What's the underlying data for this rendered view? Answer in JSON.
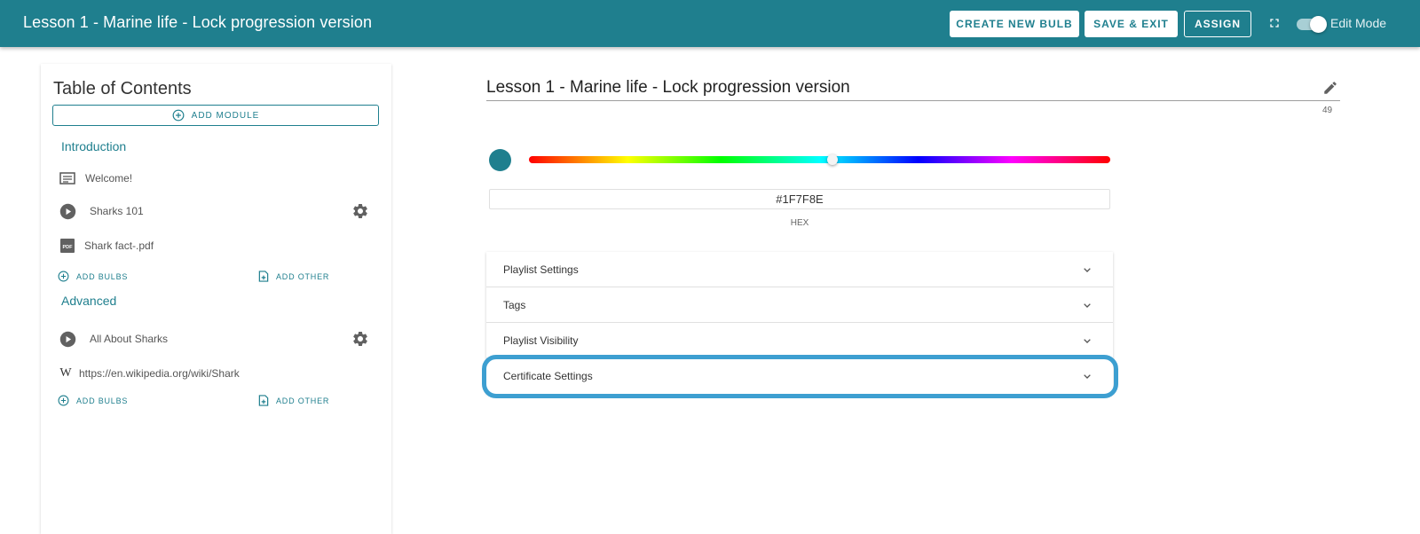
{
  "topbar": {
    "title": "Lesson 1 - Marine life - Lock progression version",
    "create_label": "CREATE NEW BULB",
    "save_label": "SAVE & EXIT",
    "assign_label": "ASSIGN",
    "edit_mode_label": "Edit Mode",
    "edit_mode_on": true
  },
  "sidebar": {
    "title": "Table of Contents",
    "add_module_label": "ADD MODULE",
    "modules": [
      {
        "title": "Introduction",
        "items": [
          {
            "label": "Welcome!",
            "icon": "article-icon"
          },
          {
            "label": "Sharks 101",
            "icon": "play-circle-icon"
          },
          {
            "label": "Shark fact-.pdf",
            "icon": "pdf-icon"
          }
        ],
        "add_bulbs_label": "ADD BULBS",
        "add_other_label": "ADD OTHER"
      },
      {
        "title": "Advanced",
        "items": [
          {
            "label": "All About Sharks",
            "icon": "play-circle-icon"
          },
          {
            "label": "https://en.wikipedia.org/wiki/Shark",
            "icon": "wikipedia-icon"
          }
        ],
        "add_bulbs_label": "ADD BULBS",
        "add_other_label": "ADD OTHER"
      }
    ]
  },
  "main": {
    "name_value": "Lesson 1 - Marine life - Lock progression version",
    "char_count": "49",
    "color": {
      "hex_value": "#1F7F8E",
      "hex_label": "HEX",
      "swatch_color": "#1f7f8e"
    },
    "accordion": [
      {
        "label": "Playlist Settings"
      },
      {
        "label": "Tags"
      },
      {
        "label": "Playlist Visibility"
      },
      {
        "label": "Certificate Settings"
      }
    ]
  },
  "colors": {
    "brand": "#1f7f8e",
    "highlight": "#3d9fd1"
  }
}
